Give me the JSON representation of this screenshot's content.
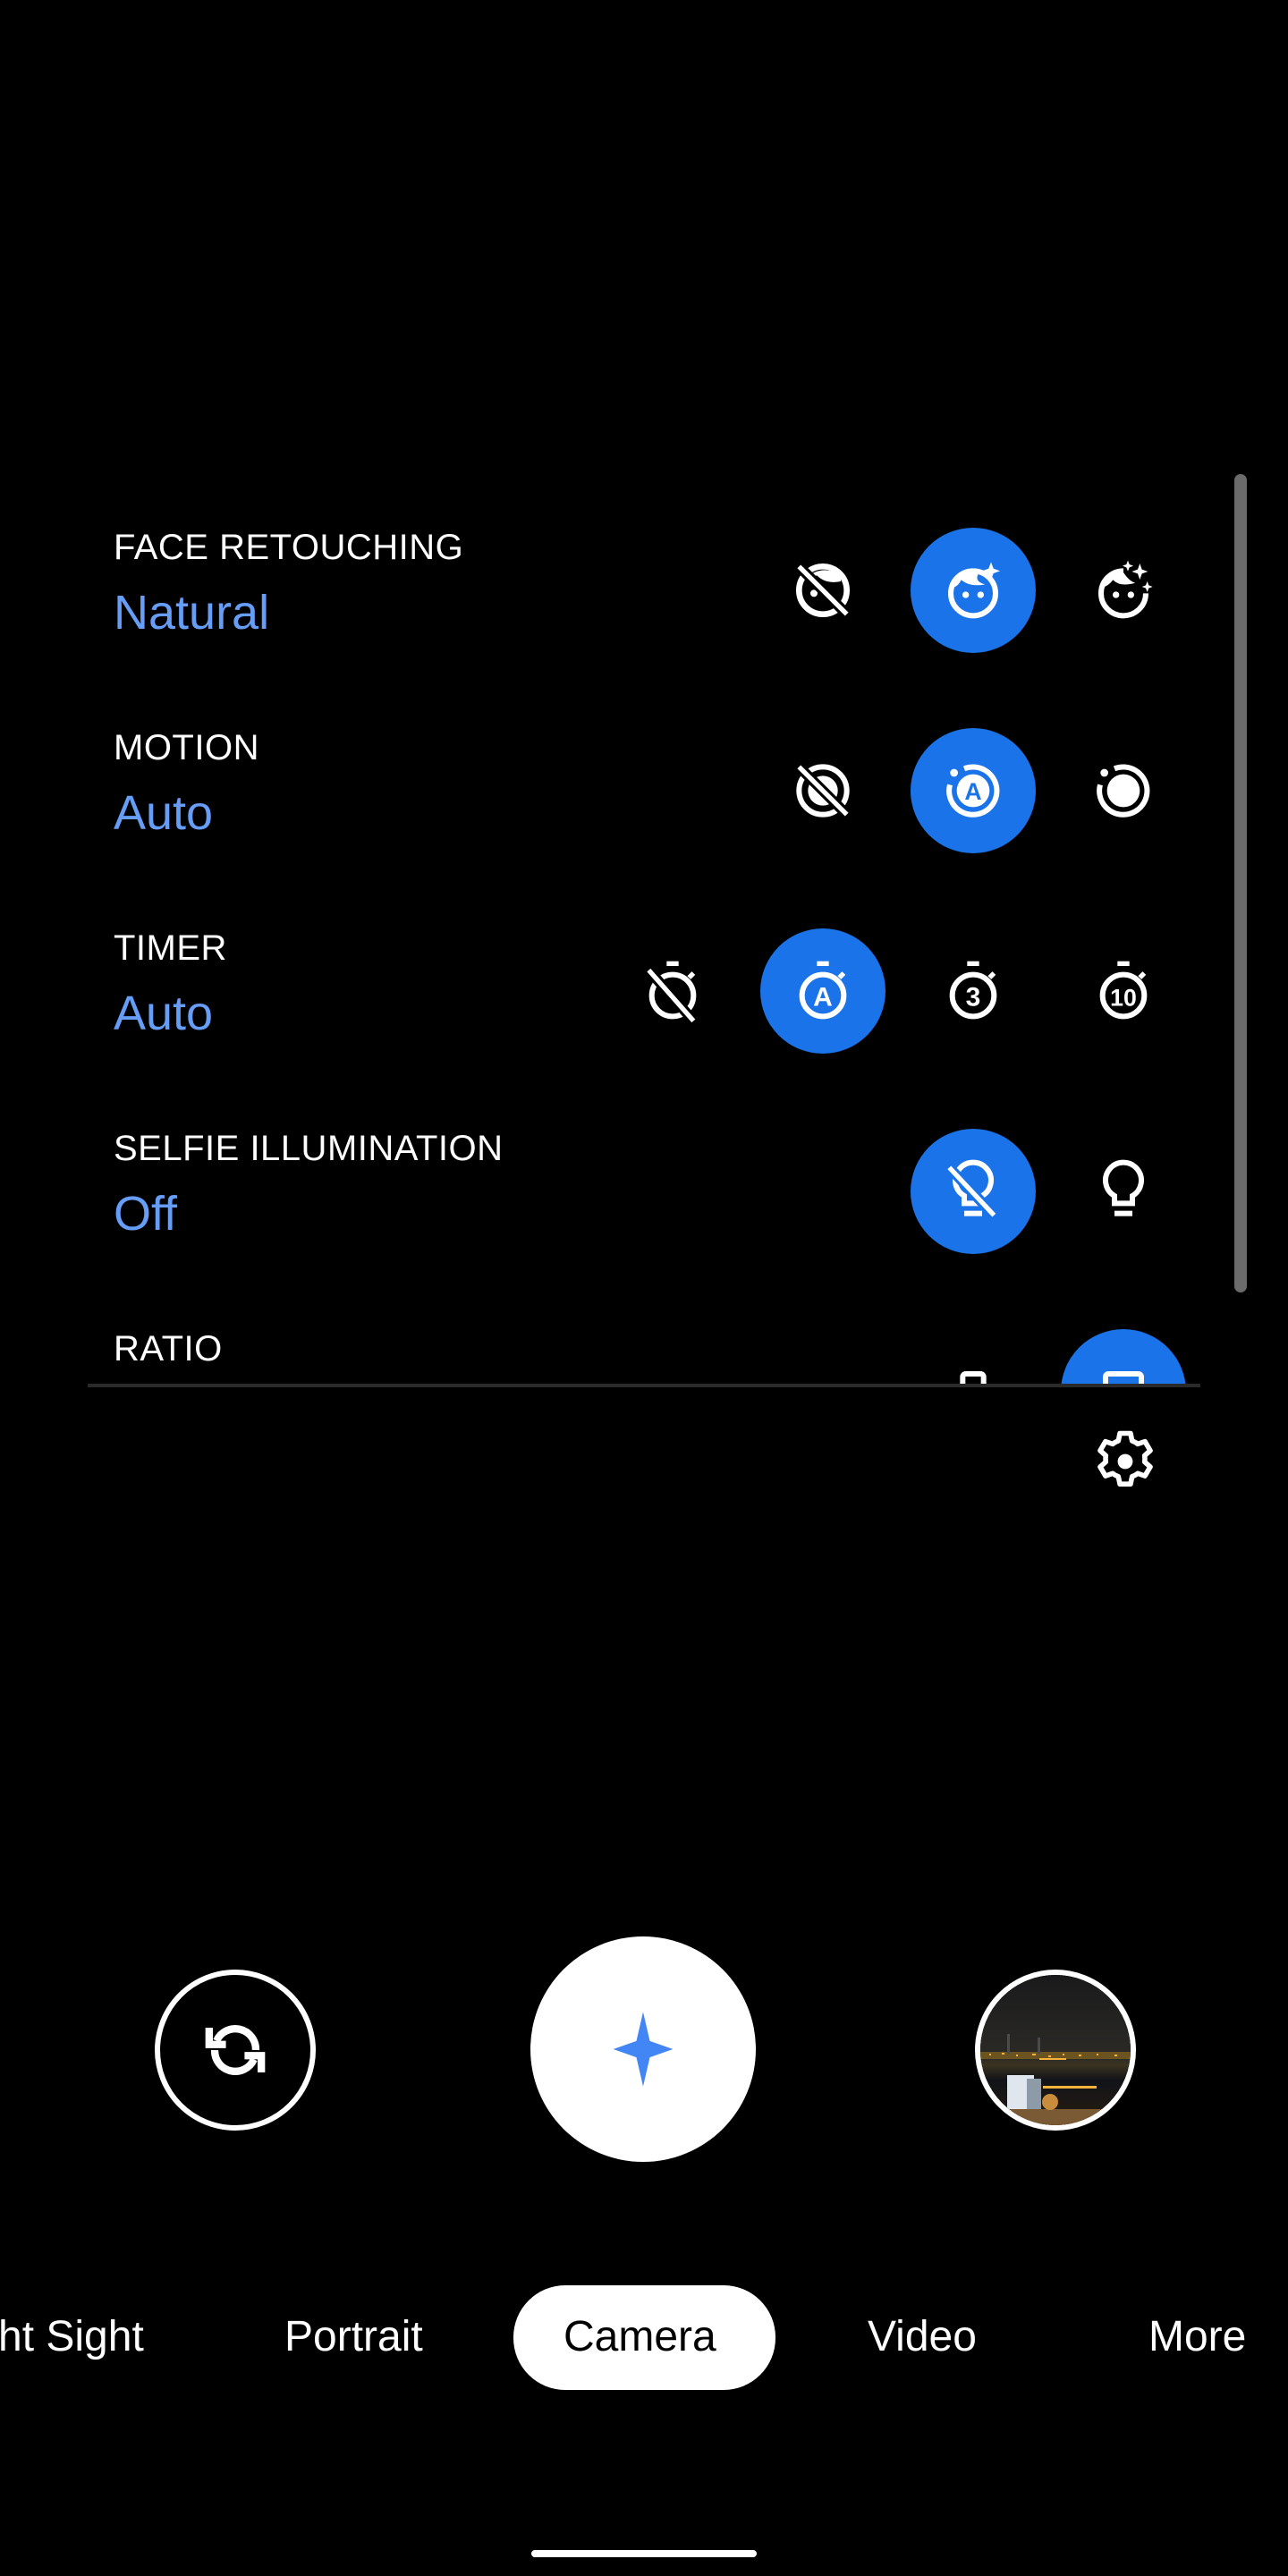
{
  "settings": {
    "rows": [
      {
        "label": "FACE RETOUCHING",
        "value": "Natural",
        "options": [
          {
            "name": "face-retouching-off",
            "selected": false
          },
          {
            "name": "face-retouching-natural",
            "selected": true
          },
          {
            "name": "face-retouching-smooth",
            "selected": false
          }
        ]
      },
      {
        "label": "MOTION",
        "value": "Auto",
        "options": [
          {
            "name": "motion-off",
            "selected": false
          },
          {
            "name": "motion-auto",
            "selected": true
          },
          {
            "name": "motion-on",
            "selected": false
          }
        ]
      },
      {
        "label": "TIMER",
        "value": "Auto",
        "options": [
          {
            "name": "timer-off",
            "selected": false
          },
          {
            "name": "timer-auto",
            "selected": true,
            "glyph": "A"
          },
          {
            "name": "timer-3s",
            "selected": false,
            "glyph": "3"
          },
          {
            "name": "timer-10s",
            "selected": false,
            "glyph": "10"
          }
        ]
      },
      {
        "label": "SELFIE ILLUMINATION",
        "value": "Off",
        "options": [
          {
            "name": "selfie-illumination-off",
            "selected": true
          },
          {
            "name": "selfie-illumination-on",
            "selected": false
          }
        ]
      },
      {
        "label": "RATIO",
        "value": "",
        "options": [
          {
            "name": "ratio-portrait",
            "selected": false
          },
          {
            "name": "ratio-full",
            "selected": true
          }
        ]
      }
    ]
  },
  "controls": {
    "flip_camera": "flip-camera-icon",
    "shutter": "shutter-sparkle-icon",
    "thumbnail": "last-photo-thumbnail",
    "settings": "gear-icon"
  },
  "modes": [
    {
      "label": "ht Sight",
      "selected": false
    },
    {
      "label": "Portrait",
      "selected": false
    },
    {
      "label": "Camera",
      "selected": true
    },
    {
      "label": "Video",
      "selected": false
    },
    {
      "label": "More",
      "selected": false
    }
  ],
  "colors": {
    "accent": "#1a73e8",
    "value_text": "#669df6",
    "shutter_star": "#4285f4"
  }
}
